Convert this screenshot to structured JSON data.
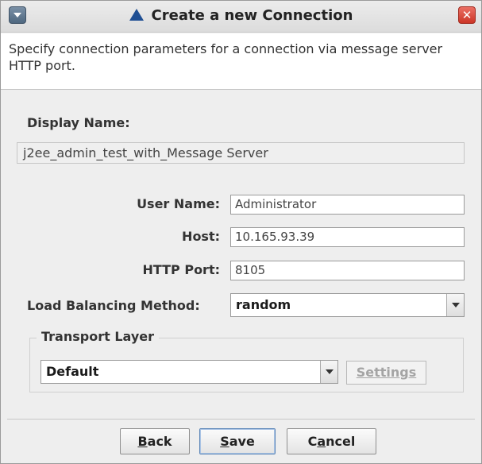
{
  "window": {
    "title": "Create a new Connection",
    "close_glyph": "✕"
  },
  "description": "Specify connection parameters for a connection via message server HTTP port.",
  "display_name": {
    "label": "Display Name:",
    "value": "j2ee_admin_test_with_Message Server"
  },
  "fields": {
    "user_name_label": "User Name:",
    "user_name_value": "Administrator",
    "host_label": "Host:",
    "host_value": "10.165.93.39",
    "http_port_label": "HTTP Port:",
    "http_port_value": "8105",
    "load_balancing_label": "Load Balancing Method:",
    "load_balancing_value": "random"
  },
  "transport": {
    "group_title": "Transport Layer",
    "value": "Default",
    "settings_label": "Settings"
  },
  "buttons": {
    "back_mnemonic": "B",
    "back_rest": "ack",
    "save_mnemonic": "S",
    "save_rest": "ave",
    "cancel_prefix": "C",
    "cancel_mnemonic": "a",
    "cancel_rest": "ncel"
  },
  "icons": {
    "window_menu": "chevron-down-icon",
    "title": "triangle-icon",
    "close": "close-icon",
    "dropdown": "chevron-down-icon"
  },
  "colors": {
    "title_icon": "#1f4f93",
    "close_button": "#cc3526",
    "default_button_border": "#5c86b8"
  }
}
